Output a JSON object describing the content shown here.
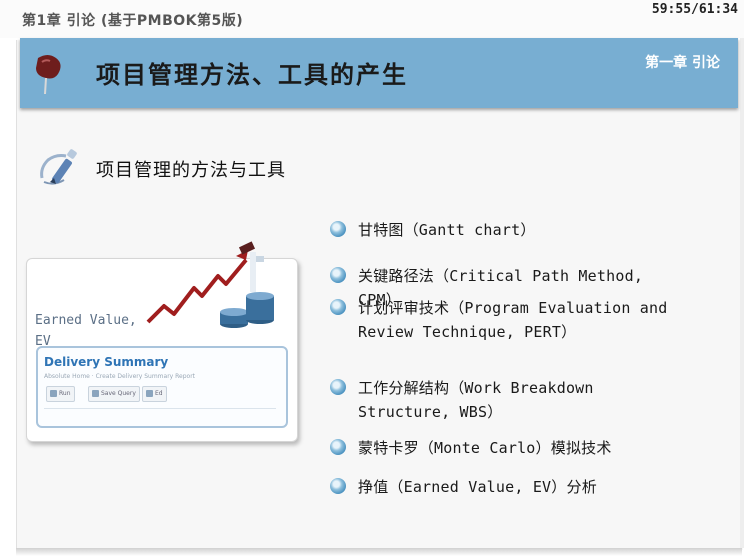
{
  "header": {
    "doc_title": "第1章 引论 (基于PMBOK第5版)",
    "timer": "59:55/61:34"
  },
  "banner": {
    "title": "项目管理方法、工具的产生",
    "chapter_label": "第一章 引论",
    "color": "#78aed2"
  },
  "section": {
    "title": "项目管理的方法与工具"
  },
  "illustration": {
    "ev_label": "Earned Value, EV",
    "summary_title": "Delivery Summary",
    "summary_sub": "Absolute Home · Create Delivery Summary Report",
    "buttons": [
      "Run",
      "Save Query",
      "Ed"
    ]
  },
  "bullets": [
    {
      "text": "甘特图（Gantt chart）",
      "icon": "bullet-dot-icon"
    },
    {
      "text": "关键路径法（Critical Path Method, CPM）",
      "icon": "bullet-dot-icon"
    },
    {
      "text": "计划评审技术（Program Evaluation and Review Technique, PERT）",
      "icon": "bullet-dot-icon"
    },
    {
      "text": "工作分解结构（Work Breakdown Structure, WBS）",
      "icon": "bullet-dot-icon"
    },
    {
      "text": "蒙特卡罗（Monte Carlo）模拟技术",
      "icon": "bullet-dot-icon"
    },
    {
      "text": "挣值（Earned Value, EV）分析",
      "icon": "bullet-dot-icon"
    }
  ]
}
